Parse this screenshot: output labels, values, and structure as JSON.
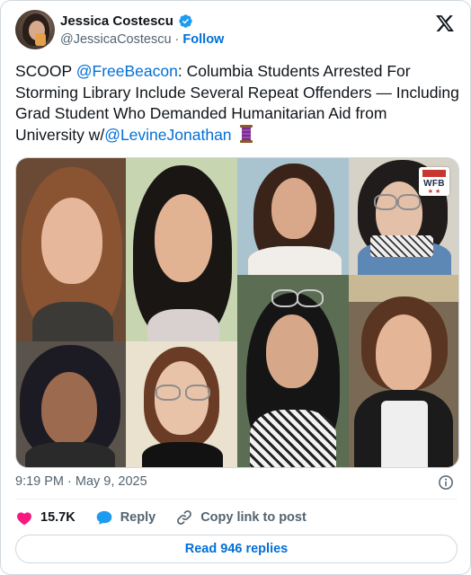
{
  "author": {
    "display_name": "Jessica Costescu",
    "handle": "@JessicaCostescu",
    "separator": "·",
    "follow_label": "Follow"
  },
  "tweet": {
    "text_parts": {
      "p1": "SCOOP ",
      "mention1": "@FreeBeacon",
      "p2": ": Columbia Students Arrested For Storming Library Include Several Repeat Offenders — Including Grad Student Who Demanded Humanitarian Aid from University w/",
      "mention2": "@LevineJonathan"
    },
    "emoji": "thread-spool-emoji"
  },
  "media": {
    "photo_count": 8,
    "watermark_text": "WFB"
  },
  "meta": {
    "timestamp": "9:19 PM · May 9, 2025"
  },
  "actions": {
    "like_count": "15.7K",
    "reply_label": "Reply",
    "copy_label": "Copy link to post"
  },
  "read_replies_label": "Read 946 replies",
  "colors": {
    "link": "#006fd6",
    "like": "#f91880",
    "reply": "#1d9bf0",
    "verified": "#1d9bf0"
  }
}
